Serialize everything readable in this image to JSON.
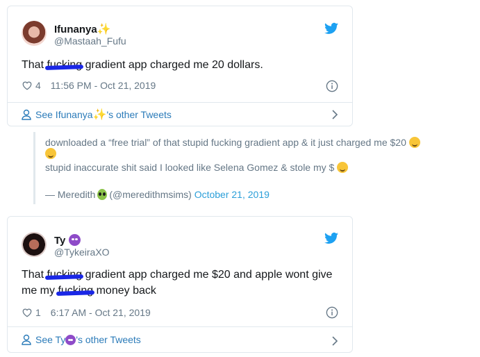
{
  "tweet1": {
    "name": "Ifunanya",
    "name_emoji": "✨",
    "handle": "@Mastaah_Fufu",
    "text_before": "That ",
    "text_redacted": "fucking",
    "text_after": " gradient app charged me 20 dollars.",
    "likes": "4",
    "timestamp": "11:56 PM - Oct 21, 2019",
    "see_prefix": "See Ifunanya",
    "see_suffix": "'s other Tweets"
  },
  "quote": {
    "line1": "downloaded a “free trial” of that stupid fucking gradient app & it just charged me $20",
    "line2": "stupid inaccurate shit said I looked like Selena Gomez & stole my $",
    "author_prefix": "— Meredith",
    "author_handle": "(@meredithmsims)",
    "date": "October 21, 2019"
  },
  "tweet2": {
    "name": "Ty",
    "handle": "@TykeiraXO",
    "line1_before": "That ",
    "line1_redacted": "fucking",
    "line1_after": " gradient app charged me $20 and apple wont give",
    "line2_before": "me my ",
    "line2_redacted": "fucking",
    "line2_after": " money back",
    "likes": "1",
    "timestamp": "6:17 AM - Oct 21, 2019",
    "see_prefix": "See Ty",
    "see_suffix": "'s other Tweets"
  },
  "colors": {
    "twitter_blue": "#1da1f2",
    "link_blue": "#2b7bb9",
    "redaction": "#1a27e6"
  },
  "icons": [
    "twitter-bird-icon",
    "heart-icon",
    "info-icon",
    "user-icon",
    "chevron-right-icon",
    "sparkles-icon",
    "smiling-devil-icon",
    "upside-down-face-icon",
    "alien-icon",
    "flushed-face-icon"
  ]
}
